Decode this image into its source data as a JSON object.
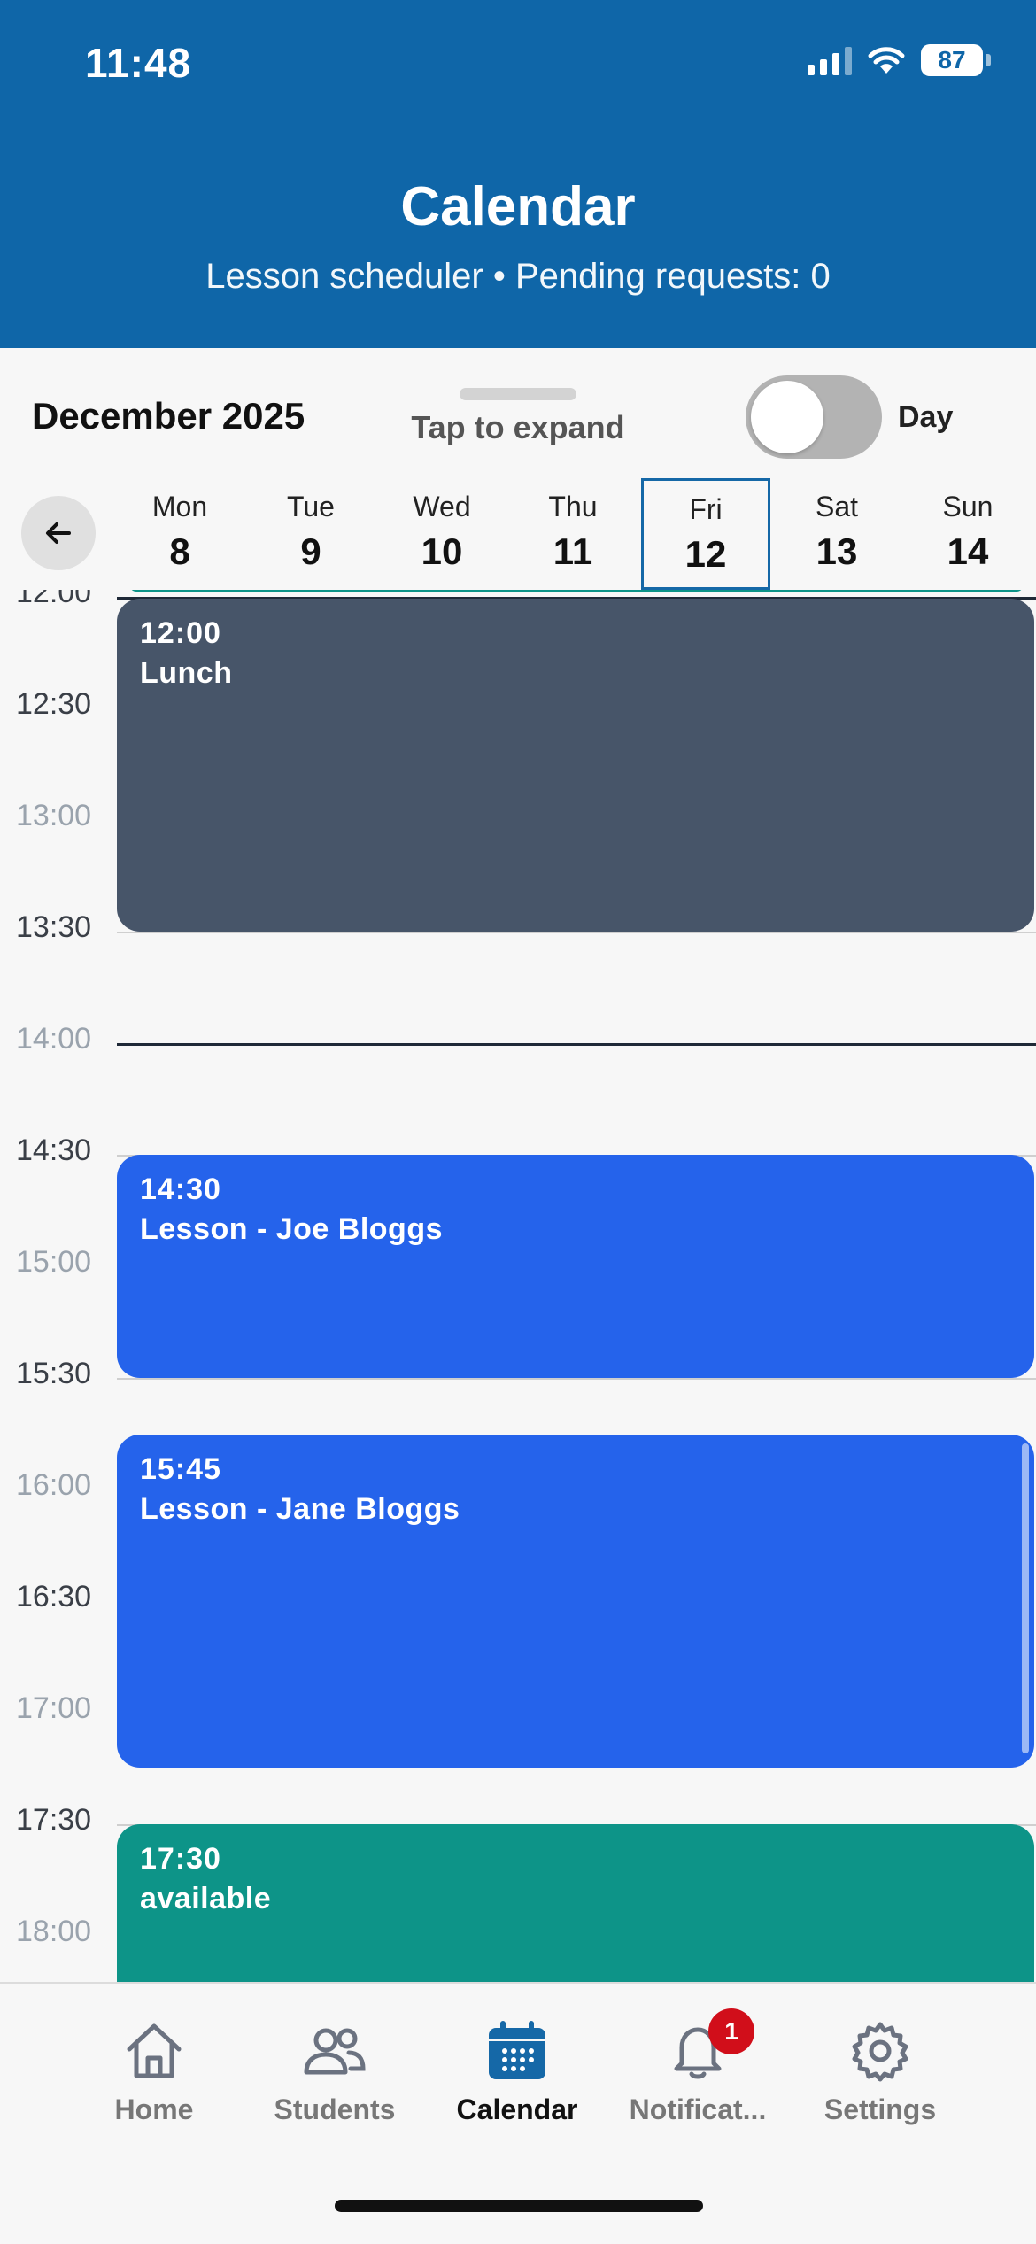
{
  "status_bar": {
    "time": "11:48",
    "battery": "87"
  },
  "header": {
    "title": "Calendar",
    "subtitle": "Lesson scheduler • Pending requests: 0"
  },
  "controls": {
    "month": "December 2025",
    "expand_label": "Tap to expand",
    "view_toggle_label": "Day",
    "view_toggle_on": false
  },
  "week": [
    {
      "name": "Mon",
      "date": "8"
    },
    {
      "name": "Tue",
      "date": "9"
    },
    {
      "name": "Wed",
      "date": "10"
    },
    {
      "name": "Thu",
      "date": "11"
    },
    {
      "name": "Fri",
      "date": "12",
      "selected": true
    },
    {
      "name": "Sat",
      "date": "13"
    },
    {
      "name": "Sun",
      "date": "14"
    }
  ],
  "timeline": {
    "times": [
      "12:00",
      "12:30",
      "13:00",
      "13:30",
      "14:00",
      "14:30",
      "15:00",
      "15:30",
      "16:00",
      "16:30",
      "17:00",
      "17:30",
      "18:00"
    ],
    "events": [
      {
        "time": "12:00",
        "title": "Lunch",
        "color": "#475569"
      },
      {
        "time": "14:30",
        "title": "Lesson - Joe Bloggs",
        "color": "#2563eb"
      },
      {
        "time": "15:45",
        "title": "Lesson - Jane Bloggs",
        "color": "#2563eb"
      },
      {
        "time": "17:30",
        "title": "available",
        "color": "#0d9488"
      }
    ]
  },
  "nav": {
    "items": [
      {
        "label": "Home",
        "icon": "home-icon"
      },
      {
        "label": "Students",
        "icon": "students-icon"
      },
      {
        "label": "Calendar",
        "icon": "calendar-icon",
        "active": true
      },
      {
        "label": "Notificat...",
        "icon": "bell-icon",
        "badge": "1"
      },
      {
        "label": "Settings",
        "icon": "gear-icon"
      }
    ]
  },
  "colors": {
    "header": "#0f66a8",
    "accent": "#1568a7",
    "lesson": "#2563eb",
    "lunch": "#475569",
    "available": "#0d9488",
    "badge": "#d10e1a"
  }
}
